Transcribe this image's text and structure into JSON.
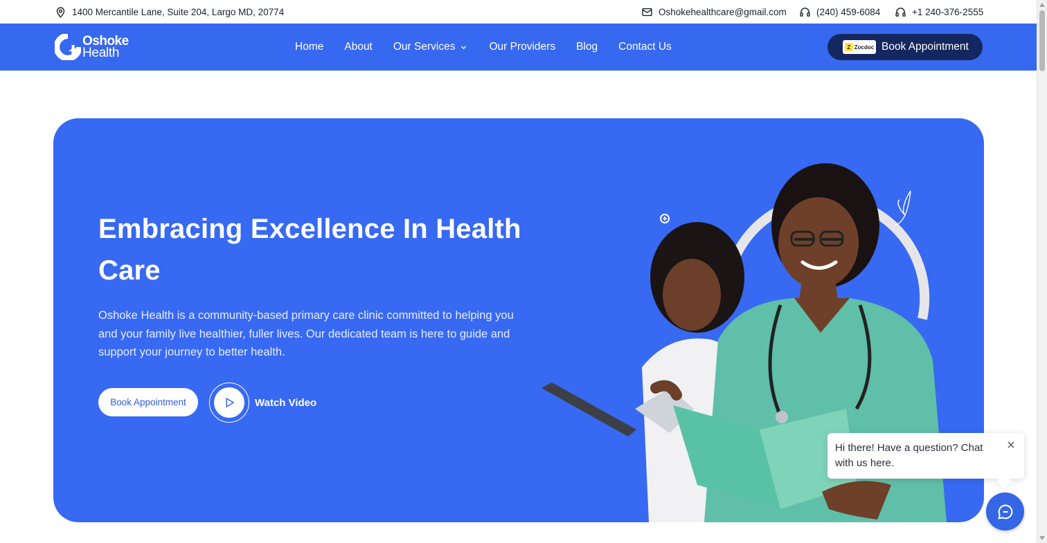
{
  "topbar": {
    "address": "1400 Mercantile Lane, Suite 204, Largo MD, 20774",
    "email": "Oshokehealthcare@gmail.com",
    "phone1": "(240) 459-6084",
    "phone2": "+1 240-376-2555"
  },
  "brand": {
    "line1": "Oshoke",
    "line2": "Health",
    "primary_color": "#3768f0",
    "dark_color": "#14275e"
  },
  "nav": {
    "items": [
      {
        "label": "Home"
      },
      {
        "label": "About"
      },
      {
        "label": "Our Services"
      },
      {
        "label": "Our Providers"
      },
      {
        "label": "Blog"
      },
      {
        "label": "Contact Us"
      }
    ],
    "book_button": "Book Appointment",
    "zocdoc_label": "Zocdoc"
  },
  "hero": {
    "title": "Embracing Excellence In Health Care",
    "description": "Oshoke Health is a community-based primary care clinic committed to helping you and your family live healthier, fuller lives. Our dedicated team is here to guide and support your journey to better health.",
    "cta_button": "Book Appointment",
    "video_label": "Watch Video"
  },
  "chat": {
    "message": "Hi there! Have a question? Chat with us here."
  },
  "icons": [
    "location-pin-icon",
    "mail-icon",
    "headset-icon",
    "chevron-down-icon",
    "play-icon",
    "close-icon",
    "chat-icon"
  ]
}
